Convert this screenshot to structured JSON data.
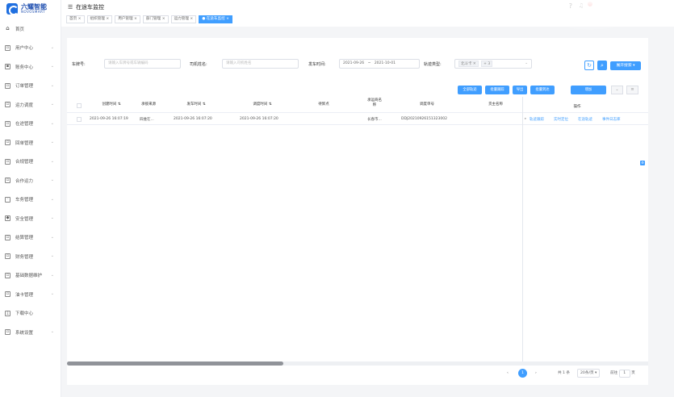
{
  "app": {
    "logo_cn": "六耀智能",
    "logo_en": "NOVOSMART"
  },
  "topbar": {
    "title": "在途车监控",
    "help_icon": "?",
    "bell_icon": "♫"
  },
  "tabs": [
    {
      "label": "首页 ×"
    },
    {
      "label": "组织管理 ×"
    },
    {
      "label": "用户管理 ×"
    },
    {
      "label": "部门管理 ×"
    },
    {
      "label": "运力管理 ×"
    },
    {
      "label": "● 在途车监控 ×"
    }
  ],
  "sidebar": {
    "items": [
      {
        "label": "首页",
        "icon": "home-icon",
        "glyph": "⌂"
      },
      {
        "label": "用户中心",
        "icon": "user-icon",
        "glyph": "▫"
      },
      {
        "label": "账务中心",
        "icon": "account-icon",
        "glyph": "▪"
      },
      {
        "label": "订单管理",
        "icon": "order-icon",
        "glyph": "▫"
      },
      {
        "label": "运力调度",
        "icon": "dispatch-icon",
        "glyph": "▫"
      },
      {
        "label": "在途管理",
        "icon": "transit-icon",
        "glyph": "▫"
      },
      {
        "label": "回单管理",
        "icon": "receipt-icon",
        "glyph": "▫"
      },
      {
        "label": "合规管理",
        "icon": "compliance-icon",
        "glyph": "▫"
      },
      {
        "label": "合作运力",
        "icon": "partner-icon",
        "glyph": "▫"
      },
      {
        "label": "车务管理",
        "icon": "vehicle-icon",
        "glyph": "◦"
      },
      {
        "label": "安全管理",
        "icon": "safety-icon",
        "glyph": "◆"
      },
      {
        "label": "结算管理",
        "icon": "settlement-icon",
        "glyph": "▫"
      },
      {
        "label": "财务管理",
        "icon": "finance-icon",
        "glyph": "▫"
      },
      {
        "label": "基础数据维护",
        "icon": "data-icon",
        "glyph": "▫"
      },
      {
        "label": "油卡管理",
        "icon": "fuelcard-icon",
        "glyph": "▫"
      },
      {
        "label": "下载中心",
        "icon": "download-icon",
        "glyph": "⤓"
      },
      {
        "label": "系统设置",
        "icon": "settings-icon",
        "glyph": "▫"
      }
    ]
  },
  "filters": {
    "plate_label": "车牌号:",
    "plate_placeholder": "请输入车牌号或车辆编码",
    "driver_label": "司机姓名:",
    "driver_placeholder": "请输入司机姓名",
    "depart_label": "发车时间:",
    "date_from": "2021-09-26",
    "date_sep": "~",
    "date_to": "2021-10-01",
    "track_label": "轨迹类型:",
    "track_tags": [
      "北斗卡 ✕",
      "+ 3"
    ],
    "more_search": "展开搜索 ▾"
  },
  "actions": {
    "btn1": "全部轨迹",
    "btn2": "批量跟踪",
    "btn3": "导出",
    "btn4": "批量到达",
    "btn5": "增加"
  },
  "table": {
    "headers": [
      "创建时间 ⇅",
      "承接来源",
      "发车时间 ⇅",
      "调度时间 ⇅",
      "待卸点",
      "承运商名称",
      "调度单号",
      "货主名称",
      "操作"
    ],
    "rows": [
      {
        "created": "2021-09-26 16:07:19",
        "source": "四维在...",
        "depart": "2021-09-26 16:07:20",
        "dispatch": "2021-09-26 16:07:20",
        "carrier": "长春市...",
        "dispatch_no": "DDJ20210926151323002",
        "ops": [
          "轨迹跟踪",
          "实时定位",
          "在途轨迹",
          "事件日志库"
        ]
      }
    ]
  },
  "pager": {
    "current": "1",
    "total": "共 1 条",
    "size": "20条/页 ▾",
    "goto_label": "前往",
    "goto_value": "1",
    "page_unit": "页"
  }
}
